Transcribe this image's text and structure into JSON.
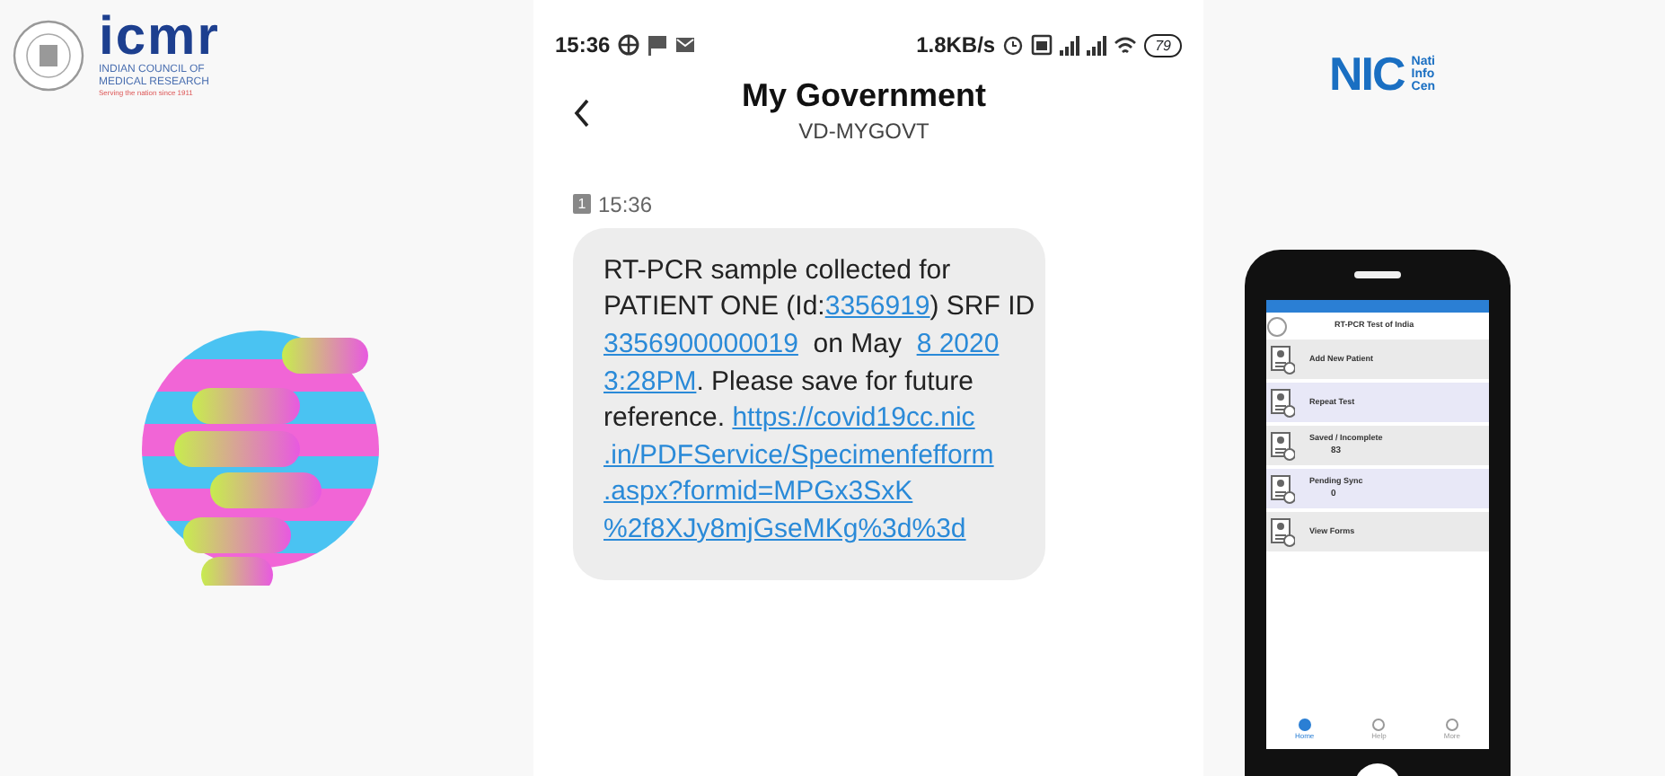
{
  "icmr_logo": {
    "wordmark": "icmr",
    "name_lines": [
      "INDIAN COUNCIL OF",
      "MEDICAL RESEARCH"
    ],
    "tagline": "Serving the nation since 1911"
  },
  "sms_screen": {
    "status_bar": {
      "time": "15:36",
      "speed": "1.8KB/s",
      "battery": "79"
    },
    "header": {
      "title": "My Government",
      "subtitle": "VD-MYGOVT"
    },
    "message": {
      "sim": "1",
      "time": "15:36",
      "lines": [
        [
          {
            "text": "RT-PCR sample collected for",
            "kind": "plain"
          }
        ],
        [
          {
            "text": "PATIENT ONE (Id:",
            "kind": "plain"
          },
          {
            "text": "3356919",
            "kind": "link"
          },
          {
            "text": ") SRF ID",
            "kind": "plain"
          }
        ],
        [
          {
            "text": "3356900000019",
            "kind": "link"
          },
          {
            "text": "  on May  ",
            "kind": "plain"
          },
          {
            "text": "8 2020",
            "kind": "link"
          }
        ],
        [
          {
            "text": "3:28PM",
            "kind": "link"
          },
          {
            "text": ". Please save for future",
            "kind": "plain"
          }
        ],
        [
          {
            "text": "reference. ",
            "kind": "plain"
          },
          {
            "text": "https://covid19cc.nic",
            "kind": "link"
          }
        ],
        [
          {
            "text": ".in/PDFService/Specimenfefform",
            "kind": "link"
          }
        ],
        [
          {
            "text": ".aspx?formid=MPGx3SxK",
            "kind": "link"
          }
        ],
        [
          {
            "text": "%2f8XJy8mjGseMKg%3d%3d",
            "kind": "link"
          }
        ]
      ]
    }
  },
  "nic_logo": {
    "wordmark": "NIC",
    "name_lines": [
      "Nati",
      "Info",
      "Cen"
    ]
  },
  "app_phone": {
    "title": "RT-PCR Test of India",
    "menu": [
      {
        "label": "Add New Patient"
      },
      {
        "label": "Repeat Test"
      },
      {
        "label": "Saved / Incomplete",
        "count": "83"
      },
      {
        "label": "Pending Sync",
        "count": "0"
      },
      {
        "label": "View Forms"
      }
    ],
    "nav": [
      {
        "label": "Home",
        "selected": true
      },
      {
        "label": "Help",
        "selected": false
      },
      {
        "label": "More",
        "selected": false
      }
    ]
  }
}
